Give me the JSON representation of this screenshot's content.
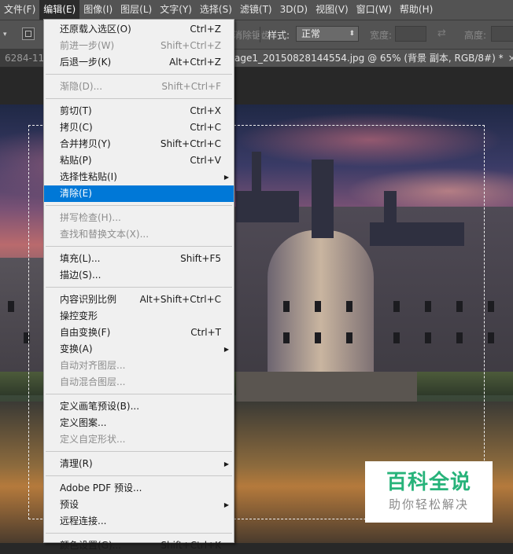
{
  "menubar": {
    "items": [
      "文件(F)",
      "编辑(E)",
      "图像(I)",
      "图层(L)",
      "文字(Y)",
      "选择(S)",
      "滤镜(T)",
      "3D(D)",
      "视图(V)",
      "窗口(W)",
      "帮助(H)"
    ],
    "active_index": 1
  },
  "options_bar": {
    "antialias_label": "消除锯齿",
    "style_label": "样式:",
    "style_value": "正常",
    "width_label": "宽度:",
    "height_label": "高度:"
  },
  "tabs": {
    "left_tab": "6284-11",
    "active_tab": "age1_20150828144554.jpg @ 65% (背景 副本, RGB/8#) *",
    "close_glyph": "×"
  },
  "edit_menu": {
    "items": [
      {
        "label": "还原载入选区(O)",
        "shortcut": "Ctrl+Z",
        "disabled": false
      },
      {
        "label": "前进一步(W)",
        "shortcut": "Shift+Ctrl+Z",
        "disabled": true
      },
      {
        "label": "后退一步(K)",
        "shortcut": "Alt+Ctrl+Z",
        "disabled": false
      },
      {
        "sep": true
      },
      {
        "label": "渐隐(D)...",
        "shortcut": "Shift+Ctrl+F",
        "disabled": true
      },
      {
        "sep": true
      },
      {
        "label": "剪切(T)",
        "shortcut": "Ctrl+X",
        "disabled": false
      },
      {
        "label": "拷贝(C)",
        "shortcut": "Ctrl+C",
        "disabled": false
      },
      {
        "label": "合并拷贝(Y)",
        "shortcut": "Shift+Ctrl+C",
        "disabled": false
      },
      {
        "label": "粘贴(P)",
        "shortcut": "Ctrl+V",
        "disabled": false
      },
      {
        "label": "选择性粘贴(I)",
        "shortcut": "",
        "submenu": true,
        "disabled": false
      },
      {
        "label": "清除(E)",
        "shortcut": "",
        "highlighted": true,
        "disabled": false
      },
      {
        "sep": true
      },
      {
        "label": "拼写检查(H)...",
        "shortcut": "",
        "disabled": true
      },
      {
        "label": "查找和替换文本(X)...",
        "shortcut": "",
        "disabled": true
      },
      {
        "sep": true
      },
      {
        "label": "填充(L)...",
        "shortcut": "Shift+F5",
        "disabled": false
      },
      {
        "label": "描边(S)...",
        "shortcut": "",
        "disabled": false
      },
      {
        "sep": true
      },
      {
        "label": "内容识别比例",
        "shortcut": "Alt+Shift+Ctrl+C",
        "disabled": false
      },
      {
        "label": "操控变形",
        "shortcut": "",
        "disabled": false
      },
      {
        "label": "自由变换(F)",
        "shortcut": "Ctrl+T",
        "disabled": false
      },
      {
        "label": "变换(A)",
        "shortcut": "",
        "submenu": true,
        "disabled": false
      },
      {
        "label": "自动对齐图层...",
        "shortcut": "",
        "disabled": true
      },
      {
        "label": "自动混合图层...",
        "shortcut": "",
        "disabled": true
      },
      {
        "sep": true
      },
      {
        "label": "定义画笔预设(B)...",
        "shortcut": "",
        "disabled": false
      },
      {
        "label": "定义图案...",
        "shortcut": "",
        "disabled": false
      },
      {
        "label": "定义自定形状...",
        "shortcut": "",
        "disabled": true
      },
      {
        "sep": true
      },
      {
        "label": "清理(R)",
        "shortcut": "",
        "submenu": true,
        "disabled": false
      },
      {
        "sep": true
      },
      {
        "label": "Adobe PDF 预设...",
        "shortcut": "",
        "disabled": false
      },
      {
        "label": "预设",
        "shortcut": "",
        "submenu": true,
        "disabled": false
      },
      {
        "label": "远程连接...",
        "shortcut": "",
        "disabled": false
      },
      {
        "sep": true
      },
      {
        "label": "颜色设置(G)...",
        "shortcut": "Shift+Ctrl+K",
        "disabled": false
      }
    ]
  },
  "watermark": {
    "title": "百科全说",
    "subtitle": "助你轻松解决"
  },
  "colors": {
    "highlight": "#0078d7",
    "menubar_bg": "#535353",
    "watermark_green": "#27b37a"
  }
}
